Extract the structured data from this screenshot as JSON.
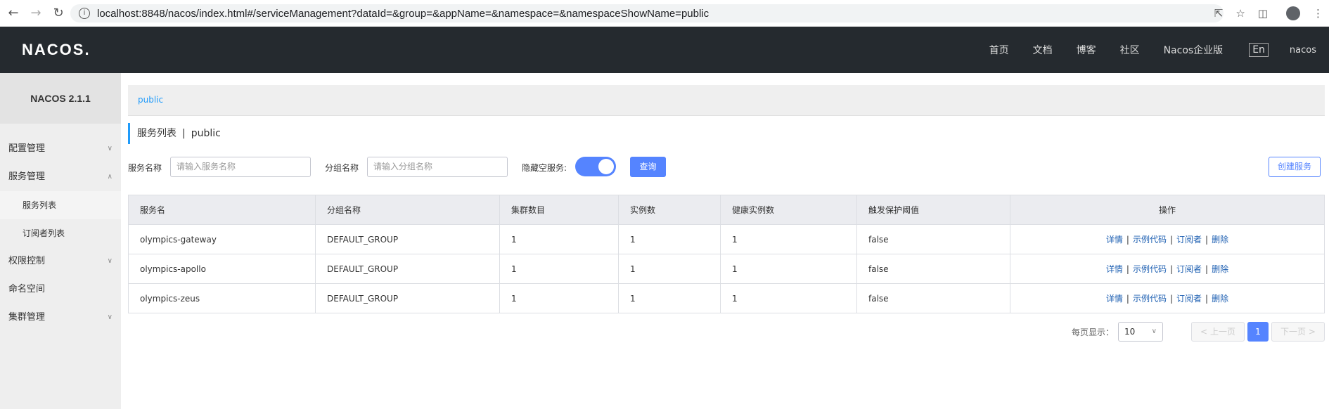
{
  "browser": {
    "url": "localhost:8848/nacos/index.html#/serviceManagement?dataId=&group=&appName=&namespace=&namespaceShowName=public",
    "back_icon": "arrow-left-icon",
    "forward_icon": "arrow-right-icon",
    "reload_icon": "reload-icon"
  },
  "header": {
    "logo": "NACOS.",
    "nav": [
      "首页",
      "文档",
      "博客",
      "社区",
      "Nacos企业版"
    ],
    "lang": "En",
    "user": "nacos"
  },
  "sidebar": {
    "version": "NACOS 2.1.1",
    "items": [
      {
        "label": "配置管理",
        "chevron": "down"
      },
      {
        "label": "服务管理",
        "chevron": "up"
      },
      {
        "label": "服务列表",
        "sub": true,
        "active": true
      },
      {
        "label": "订阅者列表",
        "sub": true
      },
      {
        "label": "权限控制",
        "chevron": "down"
      },
      {
        "label": "命名空间"
      },
      {
        "label": "集群管理",
        "chevron": "down"
      }
    ]
  },
  "main": {
    "namespace_link": "public",
    "title": "服务列表",
    "title_sep": "|",
    "title_ns": "public",
    "filters": {
      "service_name_label": "服务名称",
      "service_name_placeholder": "请输入服务名称",
      "group_name_label": "分组名称",
      "group_name_placeholder": "请输入分组名称",
      "hide_empty_label": "隐藏空服务:",
      "hide_empty_on": true,
      "query_button": "查询",
      "create_button": "创建服务"
    },
    "table": {
      "headers": [
        "服务名",
        "分组名称",
        "集群数目",
        "实例数",
        "健康实例数",
        "触发保护阈值",
        "操作"
      ],
      "rows": [
        [
          "olympics-gateway",
          "DEFAULT_GROUP",
          "1",
          "1",
          "1",
          "false"
        ],
        [
          "olympics-apollo",
          "DEFAULT_GROUP",
          "1",
          "1",
          "1",
          "false"
        ],
        [
          "olympics-zeus",
          "DEFAULT_GROUP",
          "1",
          "1",
          "1",
          "false"
        ]
      ],
      "ops": [
        "详情",
        "示例代码",
        "订阅者",
        "删除"
      ]
    },
    "pager": {
      "per_page_label": "每页显示：",
      "per_page": "10",
      "prev": "上一页",
      "current": "1",
      "next": "下一页"
    }
  }
}
